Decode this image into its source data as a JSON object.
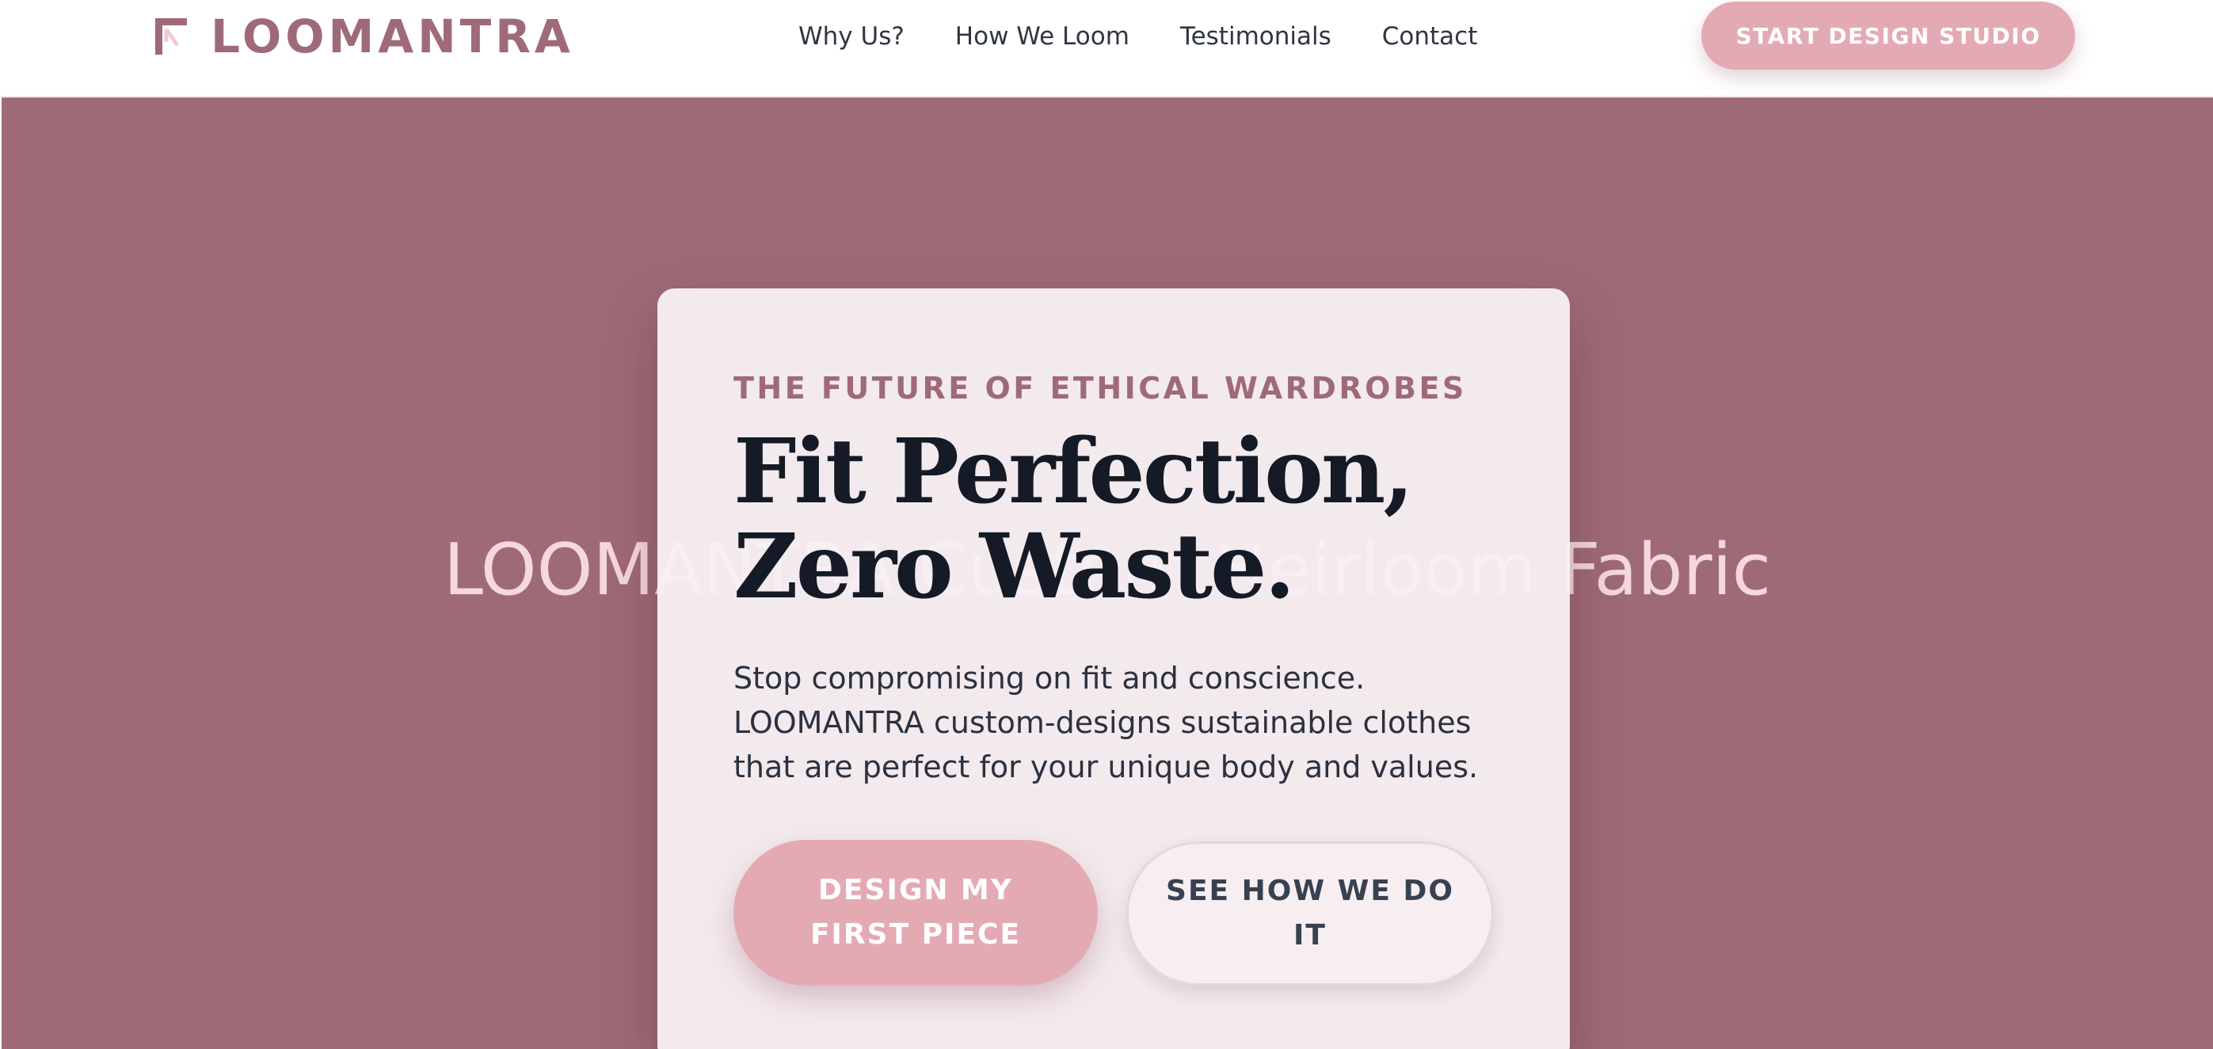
{
  "brand": {
    "name": "LOOMANTRA",
    "logo_icon": "loom-logo-icon"
  },
  "nav": {
    "links": [
      "Why Us?",
      "How We Loom",
      "Testimonials",
      "Contact"
    ],
    "cta_label": "START DESIGN STUDIO"
  },
  "hero": {
    "watermark": "LOOMANTRA Custom Heirloom Fabric",
    "eyebrow": "THE FUTURE OF ETHICAL WARDROBES",
    "headline_lines": [
      "Fit Perfection,",
      "Zero Waste."
    ],
    "description": "Stop compromising on fit and conscience. LOOMANTRA custom-designs sustainable clothes that are perfect for your unique body and values.",
    "primary_button_lines": [
      "DESIGN MY",
      "FIRST PIECE"
    ],
    "secondary_button_lines": [
      "SEE HOW WE DO",
      "IT"
    ]
  },
  "colors": {
    "brand": "#9f6a77",
    "accent_pink": "#e4aab4",
    "hero_background": "#9f6a77",
    "card_background": "#f7eff1",
    "headline": "#141a26"
  }
}
